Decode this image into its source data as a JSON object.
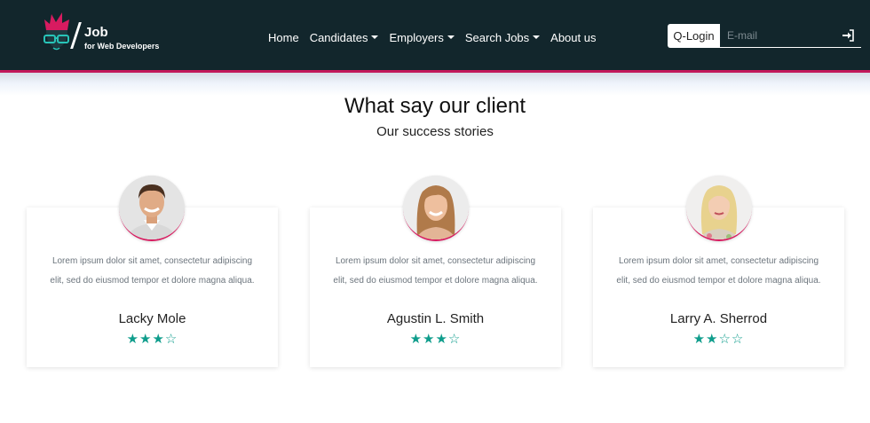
{
  "brand": {
    "name": "Job",
    "tagline": "for Web Developers"
  },
  "nav": {
    "items": [
      {
        "label": "Home",
        "dropdown": false
      },
      {
        "label": "Candidates",
        "dropdown": true
      },
      {
        "label": "Employers",
        "dropdown": true
      },
      {
        "label": "Search Jobs",
        "dropdown": true
      },
      {
        "label": "About us",
        "dropdown": false
      }
    ]
  },
  "login": {
    "button_label": "Q-Login",
    "email_placeholder": "E-mail",
    "submit_icon": "sign-in-icon"
  },
  "section": {
    "title": "What say our client",
    "subtitle": "Our success stories"
  },
  "testimonials": [
    {
      "quote": "Lorem ipsum dolor sit amet, consectetur adipiscing elit, sed do eiusmod tempor et dolore magna aliqua.",
      "name": "Lacky Mole",
      "rating": 3,
      "max_rating": 5,
      "stars": "★★★☆"
    },
    {
      "quote": "Lorem ipsum dolor sit amet, consectetur adipiscing elit, sed do eiusmod tempor et dolore magna aliqua.",
      "name": "Agustin L. Smith",
      "rating": 3,
      "max_rating": 5,
      "stars": "★★★☆"
    },
    {
      "quote": "Lorem ipsum dolor sit amet, consectetur adipiscing elit, sed do eiusmod tempor et dolore magna aliqua.",
      "name": "Larry A. Sherrod",
      "rating": 2,
      "max_rating": 5,
      "stars": "★★☆☆"
    }
  ],
  "colors": {
    "navbar_bg": "#12262c",
    "accent_pink": "#c2185b",
    "star_teal": "#0f9d8c"
  }
}
